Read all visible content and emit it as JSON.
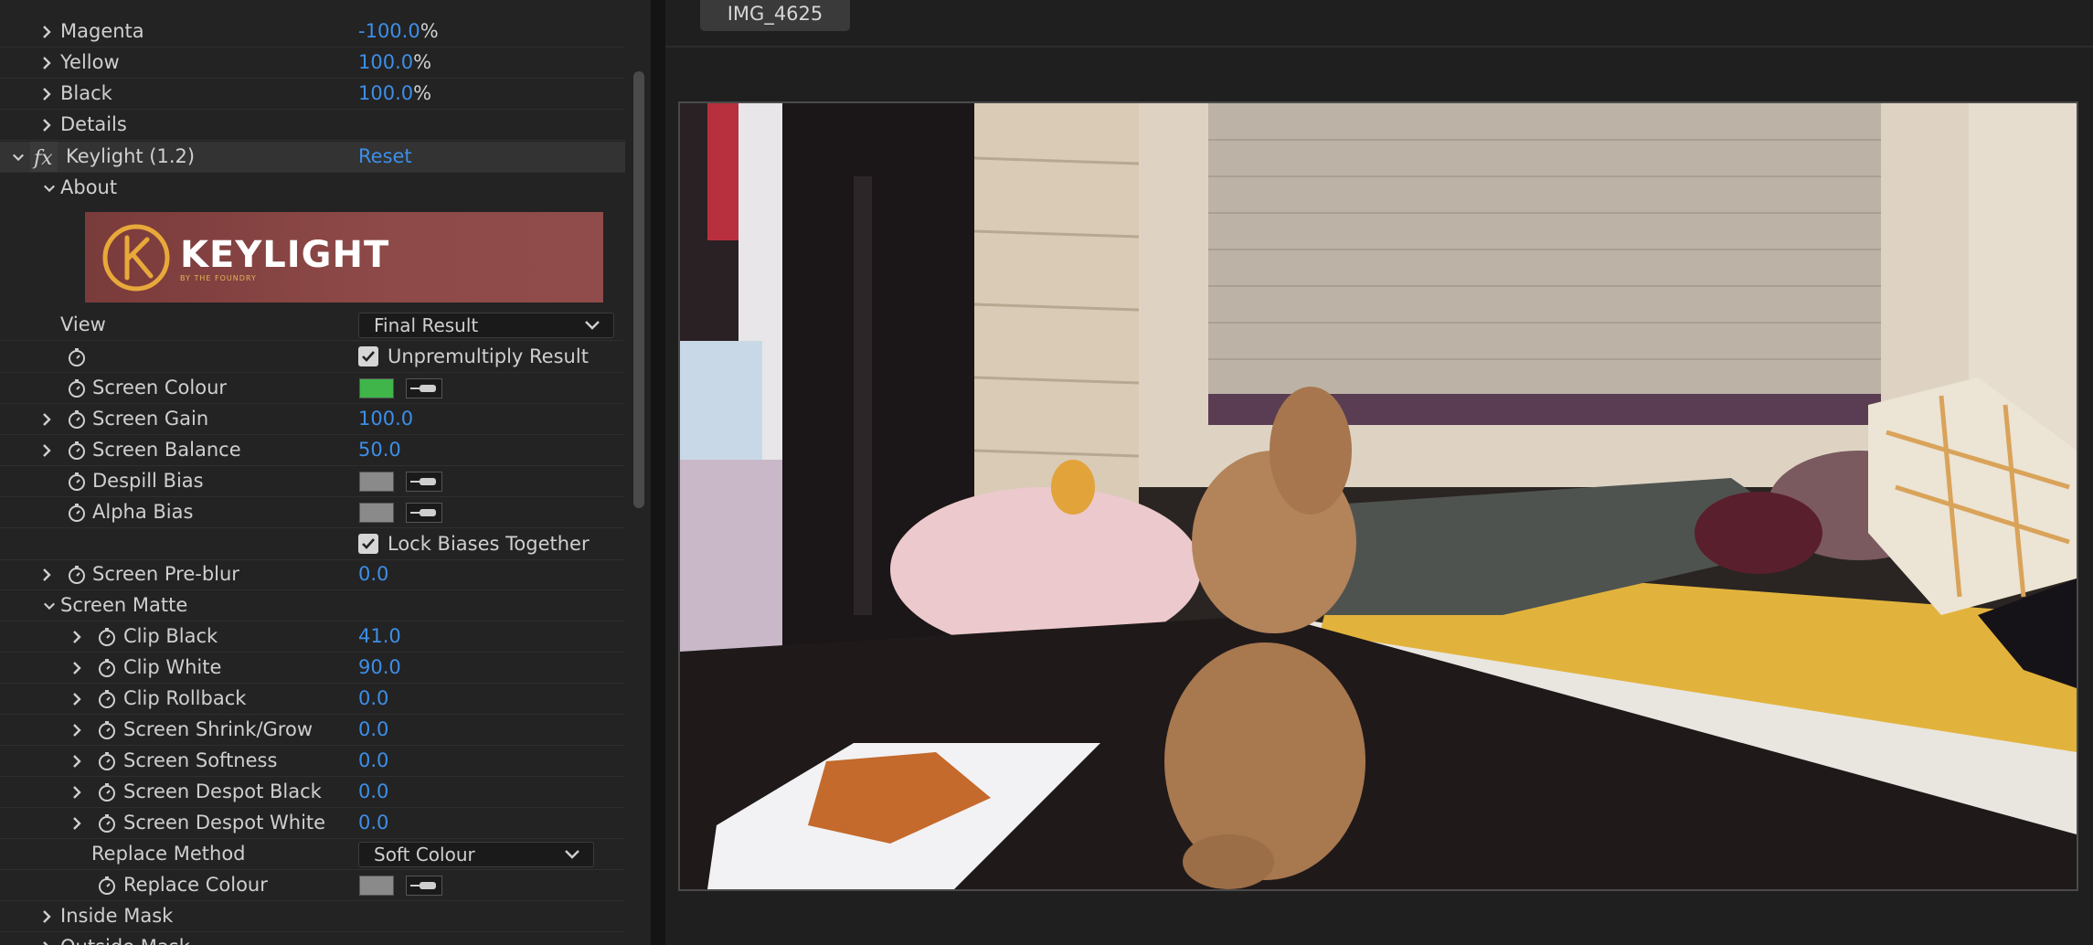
{
  "effect_controls": {
    "rows": [
      {
        "id": "magenta",
        "label": "Magenta",
        "value": "-100.0",
        "unit": "%"
      },
      {
        "id": "yellow",
        "label": "Yellow",
        "value": "100.0",
        "unit": "%"
      },
      {
        "id": "black",
        "label": "Black",
        "value": "100.0",
        "unit": "%"
      },
      {
        "id": "details",
        "label": "Details"
      },
      {
        "id": "keylight",
        "label": "Keylight (1.2)",
        "action": "Reset",
        "fx_symbol": "fx"
      },
      {
        "id": "about",
        "label": "About"
      },
      {
        "id": "view",
        "label": "View",
        "dropdown": "Final Result"
      },
      {
        "id": "unpremultiply",
        "checkbox_label": "Unpremultiply Result",
        "checked": true
      },
      {
        "id": "screen_colour",
        "label": "Screen Colour",
        "swatch_color": "#3fb54a"
      },
      {
        "id": "screen_gain",
        "label": "Screen Gain",
        "value": "100.0"
      },
      {
        "id": "screen_balance",
        "label": "Screen Balance",
        "value": "50.0"
      },
      {
        "id": "despill_bias",
        "label": "Despill Bias",
        "swatch_color": "#8a8a8a"
      },
      {
        "id": "alpha_bias",
        "label": "Alpha Bias",
        "swatch_color": "#8a8a8a"
      },
      {
        "id": "lock_biases",
        "checkbox_label": "Lock Biases Together",
        "checked": true
      },
      {
        "id": "screen_preblur",
        "label": "Screen Pre-blur",
        "value": "0.0"
      },
      {
        "id": "screen_matte",
        "label": "Screen Matte"
      },
      {
        "id": "clip_black",
        "label": "Clip Black",
        "value": "41.0"
      },
      {
        "id": "clip_white",
        "label": "Clip White",
        "value": "90.0"
      },
      {
        "id": "clip_rollback",
        "label": "Clip Rollback",
        "value": "0.0"
      },
      {
        "id": "screen_shrink_grow",
        "label": "Screen Shrink/Grow",
        "value": "0.0"
      },
      {
        "id": "screen_softness",
        "label": "Screen Softness",
        "value": "0.0"
      },
      {
        "id": "screen_despot_black",
        "label": "Screen Despot Black",
        "value": "0.0"
      },
      {
        "id": "screen_despot_white",
        "label": "Screen Despot White",
        "value": "0.0"
      },
      {
        "id": "replace_method",
        "label": "Replace Method",
        "dropdown": "Soft Colour"
      },
      {
        "id": "replace_colour",
        "label": "Replace Colour",
        "swatch_color": "#8a8a8a"
      },
      {
        "id": "inside_mask",
        "label": "Inside Mask"
      },
      {
        "id": "outside_mask",
        "label": "Outside Mask"
      }
    ],
    "keylight_logo": {
      "wordmark": "KEYLIGHT",
      "tagline": "BY THE FOUNDRY"
    }
  },
  "viewer": {
    "tab_label": "IMG_4625"
  },
  "colors": {
    "accent_blue": "#3d8ee8",
    "panel_bg": "#232323",
    "logo_gold": "#e8a93a"
  },
  "icons": {
    "chevron_right": "chevron-right-icon",
    "chevron_down": "chevron-down-icon",
    "stopwatch": "stopwatch-icon",
    "eyedropper": "eyedropper-icon",
    "checkmark": "checkmark-icon"
  }
}
